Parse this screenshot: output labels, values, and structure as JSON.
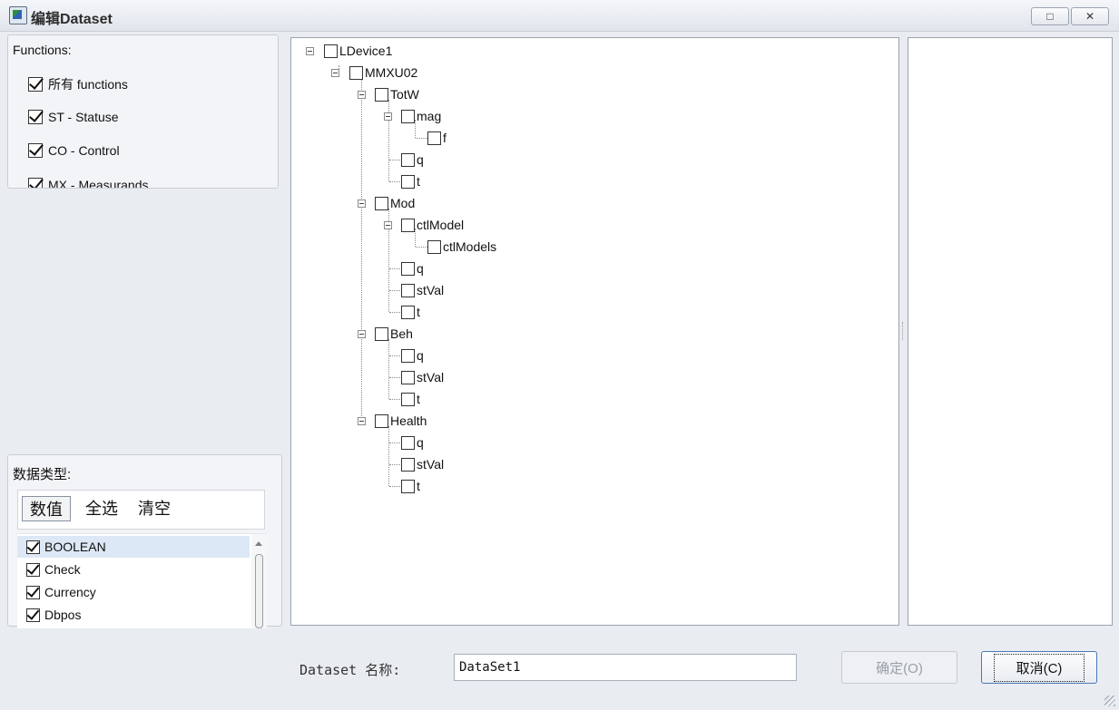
{
  "window": {
    "title": "编辑Dataset",
    "restore_label": "□",
    "close_label": "✕"
  },
  "functions": {
    "title": "Functions:",
    "items": [
      {
        "label": "所有 functions",
        "checked": true
      },
      {
        "label": "ST - Statuse",
        "checked": true
      },
      {
        "label": "CO - Control",
        "checked": true
      },
      {
        "label": "MX - Measurands",
        "checked": true
      }
    ]
  },
  "datatypes": {
    "title": "数据类型:",
    "tabs": [
      "数值",
      "全选",
      "清空"
    ],
    "items": [
      {
        "label": "BOOLEAN",
        "checked": true
      },
      {
        "label": "Check",
        "checked": true
      },
      {
        "label": "Currency",
        "checked": true
      },
      {
        "label": "Dbpos",
        "checked": true
      }
    ]
  },
  "tree": {
    "nodes": [
      "LDevice1",
      "MMXU02",
      "TotW",
      "mag",
      "f",
      "q",
      "t",
      "Mod",
      "ctlModel",
      "ctlModels",
      "q",
      "stVal",
      "t",
      "Beh",
      "q",
      "stVal",
      "t",
      "Health",
      "q",
      "stVal",
      "t"
    ]
  },
  "footer": {
    "dataset_label": "Dataset 名称:",
    "dataset_value": "DataSet1",
    "ok_label": "确定(O)",
    "cancel_label": "取消(C)"
  },
  "colors": {
    "accent": "#4a78b8",
    "selection": "#dde8f6",
    "window_bg": "#e9ecf1"
  }
}
